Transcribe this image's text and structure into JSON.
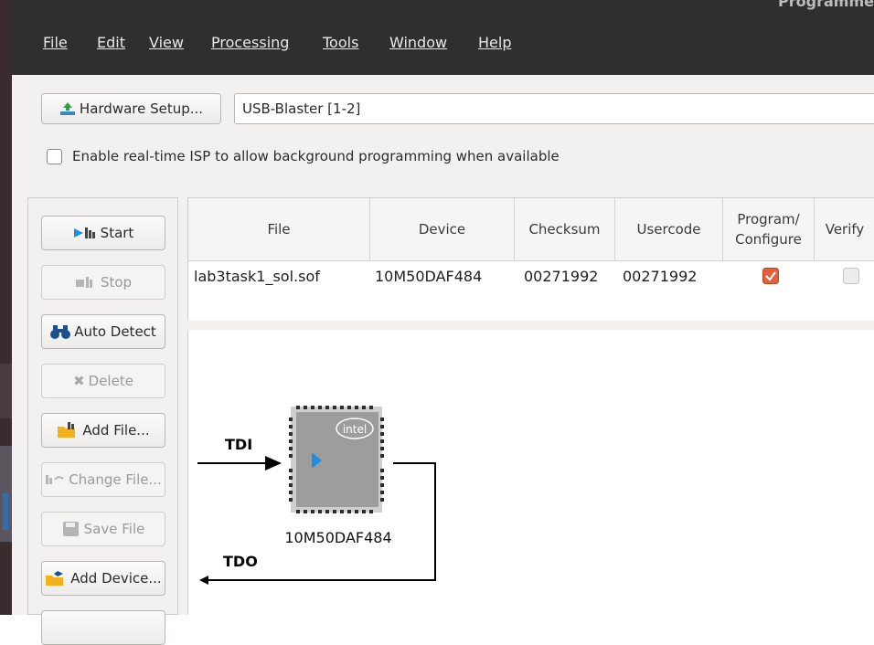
{
  "window": {
    "title_fragment": "Programme"
  },
  "menubar": {
    "items": [
      {
        "label": "File"
      },
      {
        "label": "Edit"
      },
      {
        "label": "View"
      },
      {
        "label": "Processing"
      },
      {
        "label": "Tools"
      },
      {
        "label": "Window"
      },
      {
        "label": "Help"
      }
    ]
  },
  "toolbar": {
    "hardware_setup_label": "Hardware Setup...",
    "hardware_value": "USB-Blaster [1-2]",
    "realtime_isp_label": "Enable real-time ISP to allow background programming when available",
    "realtime_isp_checked": false
  },
  "sidebar": {
    "start": "Start",
    "stop": "Stop",
    "auto_detect": "Auto Detect",
    "delete": "Delete",
    "add_file": "Add File...",
    "change_file": "Change File...",
    "save_file": "Save File",
    "add_device": "Add Device..."
  },
  "table": {
    "headers": {
      "file": "File",
      "device": "Device",
      "checksum": "Checksum",
      "usercode": "Usercode",
      "program_line1": "Program/",
      "program_line2": "Configure",
      "verify": "Verify"
    },
    "rows": [
      {
        "file": "lab3task1_sol.sof",
        "device": "10M50DAF484",
        "checksum": "00271992",
        "usercode": "00271992",
        "program": true,
        "verify": false
      }
    ]
  },
  "diagram": {
    "tdi": "TDI",
    "tdo": "TDO",
    "chip_logo": "intel",
    "device_name": "10M50DAF484"
  },
  "colors": {
    "menubar_bg": "#2f2f2d",
    "checkbox_checked": "#e2603b",
    "chip_gray": "#9d9d9d",
    "arrow_blue": "#1f8fe0"
  }
}
